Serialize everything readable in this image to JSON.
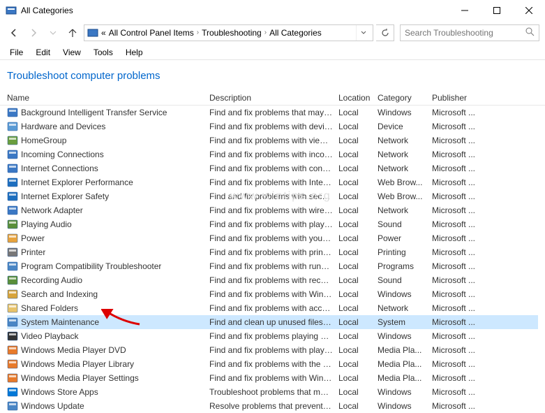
{
  "window": {
    "title": "All Categories"
  },
  "breadcrumb": {
    "prefix": "«",
    "items": [
      "All Control Panel Items",
      "Troubleshooting",
      "All Categories"
    ]
  },
  "search": {
    "placeholder": "Search Troubleshooting"
  },
  "menu": [
    "File",
    "Edit",
    "View",
    "Tools",
    "Help"
  ],
  "heading": "Troubleshoot computer problems",
  "columns": [
    "Name",
    "Description",
    "Location",
    "Category",
    "Publisher"
  ],
  "rows": [
    {
      "name": "Background Intelligent Transfer Service",
      "desc": "Find and fix problems that may p...",
      "loc": "Local",
      "cat": "Windows",
      "pub": "Microsoft ...",
      "icon": "gen"
    },
    {
      "name": "Hardware and Devices",
      "desc": "Find and fix problems with device...",
      "loc": "Local",
      "cat": "Device",
      "pub": "Microsoft ...",
      "icon": "hw"
    },
    {
      "name": "HomeGroup",
      "desc": "Find and fix problems with viewin...",
      "loc": "Local",
      "cat": "Network",
      "pub": "Microsoft ...",
      "icon": "home"
    },
    {
      "name": "Incoming Connections",
      "desc": "Find and fix problems with incom...",
      "loc": "Local",
      "cat": "Network",
      "pub": "Microsoft ...",
      "icon": "net"
    },
    {
      "name": "Internet Connections",
      "desc": "Find and fix problems with conne...",
      "loc": "Local",
      "cat": "Network",
      "pub": "Microsoft ...",
      "icon": "net"
    },
    {
      "name": "Internet Explorer Performance",
      "desc": "Find and fix problems with Intern...",
      "loc": "Local",
      "cat": "Web Brow...",
      "pub": "Microsoft ...",
      "icon": "ie"
    },
    {
      "name": "Internet Explorer Safety",
      "desc": "Find and fix problems with securi...",
      "loc": "Local",
      "cat": "Web Brow...",
      "pub": "Microsoft ...",
      "icon": "ie"
    },
    {
      "name": "Network Adapter",
      "desc": "Find and fix problems with wirele...",
      "loc": "Local",
      "cat": "Network",
      "pub": "Microsoft ...",
      "icon": "net"
    },
    {
      "name": "Playing Audio",
      "desc": "Find and fix problems with playin...",
      "loc": "Local",
      "cat": "Sound",
      "pub": "Microsoft ...",
      "icon": "audio"
    },
    {
      "name": "Power",
      "desc": "Find and fix problems with your c...",
      "loc": "Local",
      "cat": "Power",
      "pub": "Microsoft ...",
      "icon": "power"
    },
    {
      "name": "Printer",
      "desc": "Find and fix problems with printi...",
      "loc": "Local",
      "cat": "Printing",
      "pub": "Microsoft ...",
      "icon": "print"
    },
    {
      "name": "Program Compatibility Troubleshooter",
      "desc": "Find and fix problems with runni...",
      "loc": "Local",
      "cat": "Programs",
      "pub": "Microsoft ...",
      "icon": "prog"
    },
    {
      "name": "Recording Audio",
      "desc": "Find and fix problems with record...",
      "loc": "Local",
      "cat": "Sound",
      "pub": "Microsoft ...",
      "icon": "audio"
    },
    {
      "name": "Search and Indexing",
      "desc": "Find and fix problems with Wind...",
      "loc": "Local",
      "cat": "Windows",
      "pub": "Microsoft ...",
      "icon": "search"
    },
    {
      "name": "Shared Folders",
      "desc": "Find and fix problems with access...",
      "loc": "Local",
      "cat": "Network",
      "pub": "Microsoft ...",
      "icon": "folder"
    },
    {
      "name": "System Maintenance",
      "desc": "Find and clean up unused files an...",
      "loc": "Local",
      "cat": "System",
      "pub": "Microsoft ...",
      "icon": "sys",
      "selected": true
    },
    {
      "name": "Video Playback",
      "desc": "Find and fix problems playing mo...",
      "loc": "Local",
      "cat": "Windows",
      "pub": "Microsoft ...",
      "icon": "video"
    },
    {
      "name": "Windows Media Player DVD",
      "desc": "Find and fix problems with playin...",
      "loc": "Local",
      "cat": "Media Pla...",
      "pub": "Microsoft ...",
      "icon": "wmp"
    },
    {
      "name": "Windows Media Player Library",
      "desc": "Find and fix problems with the Wi...",
      "loc": "Local",
      "cat": "Media Pla...",
      "pub": "Microsoft ...",
      "icon": "wmp"
    },
    {
      "name": "Windows Media Player Settings",
      "desc": "Find and fix problems with Wind...",
      "loc": "Local",
      "cat": "Media Pla...",
      "pub": "Microsoft ...",
      "icon": "wmp"
    },
    {
      "name": "Windows Store Apps",
      "desc": "Troubleshoot problems that may ...",
      "loc": "Local",
      "cat": "Windows",
      "pub": "Microsoft ...",
      "icon": "store"
    },
    {
      "name": "Windows Update",
      "desc": "Resolve problems that prevent yo...",
      "loc": "Local",
      "cat": "Windows",
      "pub": "Microsoft ...",
      "icon": "update"
    }
  ],
  "watermark": "www.wintips.org"
}
